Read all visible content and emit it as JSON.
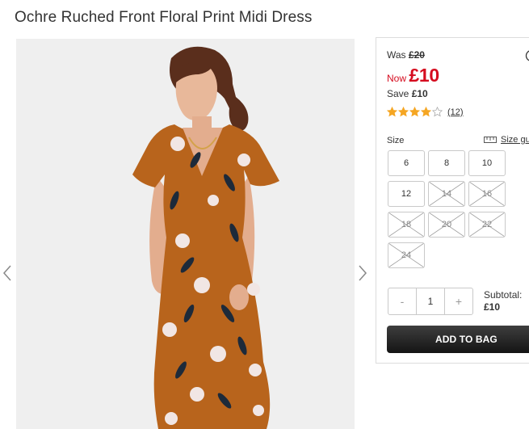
{
  "product": {
    "title": "Ochre Ruched Front Floral Print Midi Dress"
  },
  "gallery": {
    "prev_icon": "chevron-left-icon",
    "next_icon": "chevron-right-icon"
  },
  "price": {
    "was_label": "Was",
    "was_value": "£20",
    "now_label": "Now",
    "now_value": "£10",
    "save_label": "Save",
    "save_value": "£10",
    "now_color": "#d50c1f"
  },
  "rating": {
    "stars": 4,
    "max": 5,
    "count_label": "(12)",
    "star_color": "#f5a623"
  },
  "sizes": {
    "label": "Size",
    "guide_label": "Size gu",
    "guide_icon": "ruler-icon",
    "options": [
      {
        "label": "6",
        "available": true
      },
      {
        "label": "8",
        "available": true
      },
      {
        "label": "10",
        "available": true
      },
      {
        "label": "12",
        "available": true
      },
      {
        "label": "14",
        "available": false
      },
      {
        "label": "16",
        "available": false
      },
      {
        "label": "18",
        "available": false
      },
      {
        "label": "20",
        "available": false
      },
      {
        "label": "22",
        "available": false
      },
      {
        "label": "24",
        "available": false
      }
    ]
  },
  "quantity": {
    "minus": "-",
    "value": "1",
    "plus": "+"
  },
  "subtotal": {
    "label": "Subtotal:",
    "value": "£10"
  },
  "cart": {
    "add_label": "ADD TO BAG"
  }
}
